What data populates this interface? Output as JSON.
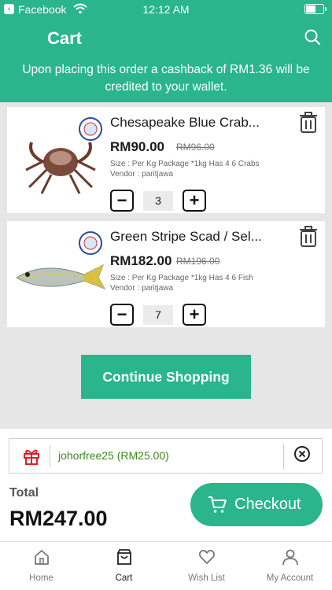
{
  "status_bar": {
    "back_app": "Facebook",
    "time": "12:12 AM"
  },
  "header": {
    "title": "Cart",
    "cashback_text": "Upon placing this order a cashback of RM1.36 will be credited to your wallet."
  },
  "cart_items": [
    {
      "name": "Chesapeake Blue Crab...",
      "price": "RM90.00",
      "old_price": "RM96.00",
      "size": "Size : Per Kg Package *1kg Has 4 6 Crabs",
      "vendor": "Vendor : paritjawa",
      "quantity": "3"
    },
    {
      "name": "Green Stripe Scad / Sel...",
      "price": "RM182.00",
      "old_price": "RM196.00",
      "size": "Size : Per Kg Package *1kg Has 4 6 Fish",
      "vendor": "Vendor : paritjawa",
      "quantity": "7"
    }
  ],
  "continue_label": "Continue Shopping",
  "coupon": {
    "code": "johorfree25 (RM25.00)"
  },
  "total": {
    "label": "Total",
    "value": "RM247.00"
  },
  "checkout_label": "Checkout",
  "tabs": [
    {
      "label": "Home",
      "icon": "home-icon"
    },
    {
      "label": "Cart",
      "icon": "bag-icon",
      "active": true
    },
    {
      "label": "Wish List",
      "icon": "heart-icon"
    },
    {
      "label": "My Account",
      "icon": "user-icon"
    }
  ],
  "colors": {
    "primary": "#2ab58c",
    "coupon_text": "#3a8a1a",
    "gift_icon": "#e02020"
  }
}
